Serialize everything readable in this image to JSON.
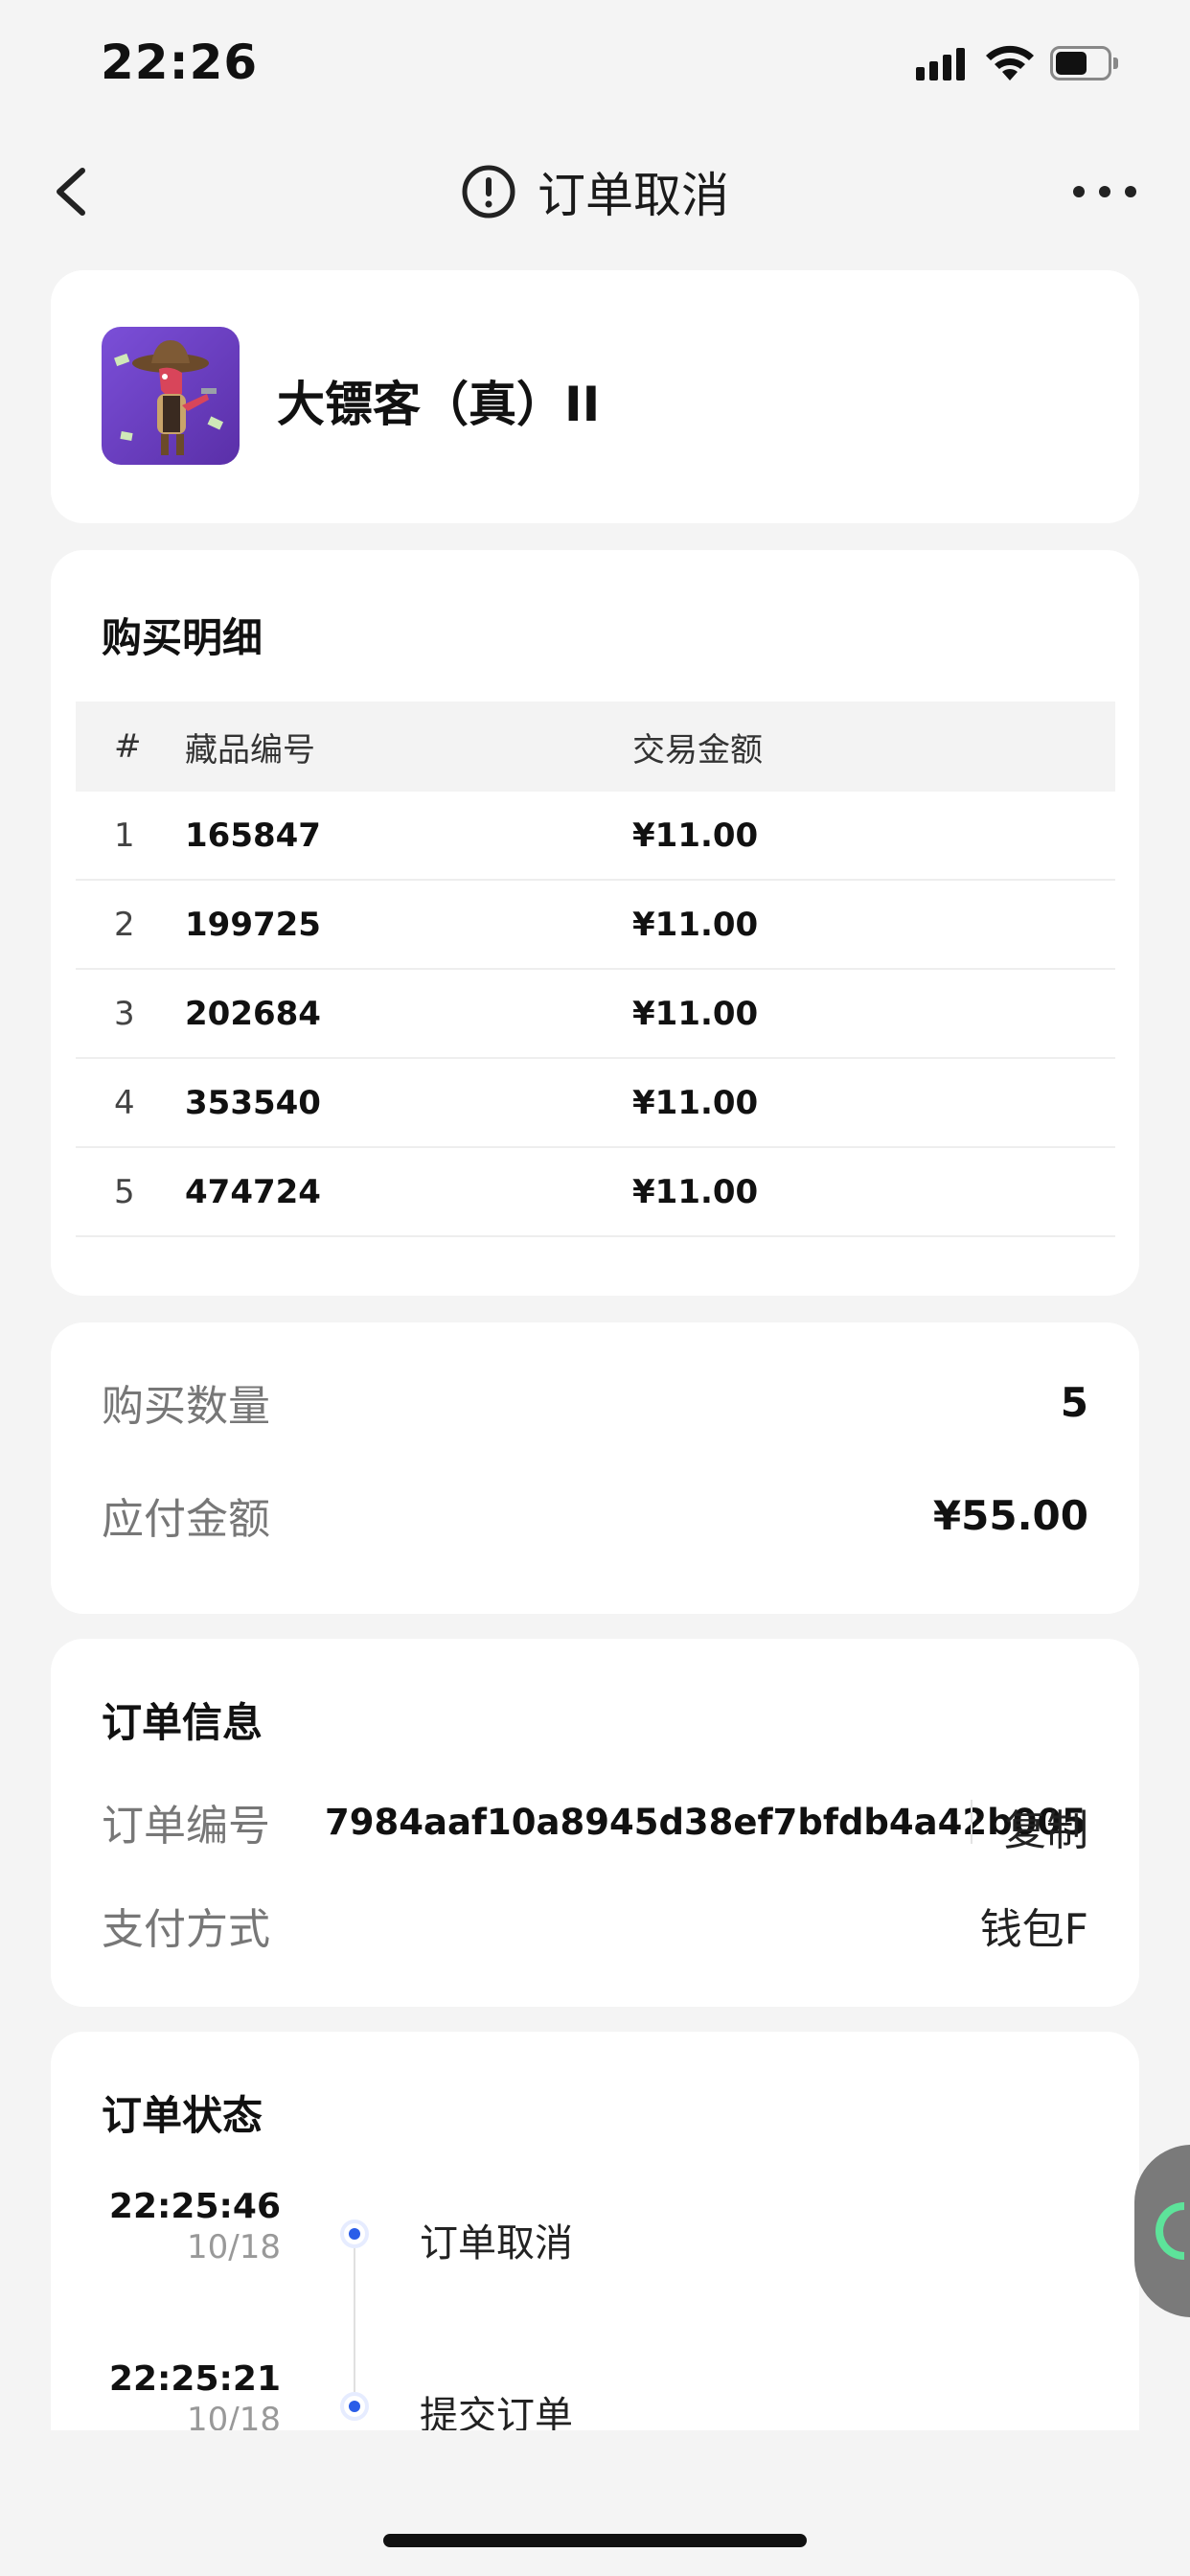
{
  "status_bar": {
    "time": "22:26"
  },
  "nav": {
    "title": "订单取消"
  },
  "product": {
    "name": "大镖客（真）II"
  },
  "purchase_detail": {
    "title": "购买明细",
    "columns": [
      "#",
      "藏品编号",
      "交易金额"
    ],
    "rows": [
      {
        "idx": "1",
        "code": "165847",
        "amount": "¥11.00"
      },
      {
        "idx": "2",
        "code": "199725",
        "amount": "¥11.00"
      },
      {
        "idx": "3",
        "code": "202684",
        "amount": "¥11.00"
      },
      {
        "idx": "4",
        "code": "353540",
        "amount": "¥11.00"
      },
      {
        "idx": "5",
        "code": "474724",
        "amount": "¥11.00"
      }
    ]
  },
  "summary": {
    "quantity_label": "购买数量",
    "quantity_value": "5",
    "payable_label": "应付金额",
    "payable_value": "¥55.00"
  },
  "order_info": {
    "title": "订单信息",
    "order_no_label": "订单编号",
    "order_no_value": "7984aaf10a8945d38ef7bfdb4a42b005",
    "copy_label": "复制",
    "pay_method_label": "支付方式",
    "pay_method_value": "钱包F"
  },
  "order_status": {
    "title": "订单状态",
    "events": [
      {
        "time": "22:25:46",
        "date": "10/18",
        "label": "订单取消"
      },
      {
        "time": "22:25:21",
        "date": "10/18",
        "label": "提交订单"
      }
    ]
  },
  "colors": {
    "accent_dot": "#2a5de8",
    "widget_green": "#5de39a"
  }
}
